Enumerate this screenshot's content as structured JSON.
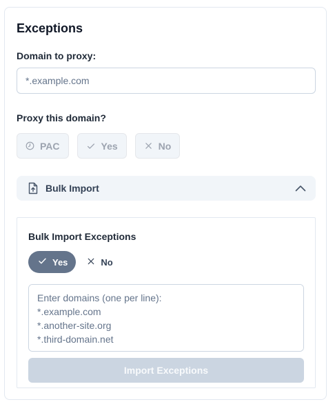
{
  "section": {
    "title": "Exceptions",
    "domain_label": "Domain to proxy:",
    "domain_placeholder": "*.example.com",
    "domain_value": "",
    "proxy_question": "Proxy this domain?",
    "proxy_options": [
      {
        "label": "PAC",
        "icon": "pac-clock-icon"
      },
      {
        "label": "Yes",
        "icon": "check-icon"
      },
      {
        "label": "No",
        "icon": "x-icon"
      }
    ]
  },
  "bulk": {
    "header_label": "Bulk Import",
    "header_icon": "file-upload-icon",
    "expanded": true,
    "panel_title": "Bulk Import Exceptions",
    "toggle_yes": "Yes",
    "toggle_no": "No",
    "toggle_selected": "Yes",
    "textarea_placeholder": "Enter domains (one per line):\n*.example.com\n*.another-site.org\n*.third-domain.net",
    "textarea_value": "",
    "import_button": "Import Exceptions"
  },
  "colors": {
    "accent_selected": "#64748b",
    "disabled_button": "#cbd5e1",
    "header_bg": "#f1f5f9",
    "border": "#e2e8f0"
  }
}
